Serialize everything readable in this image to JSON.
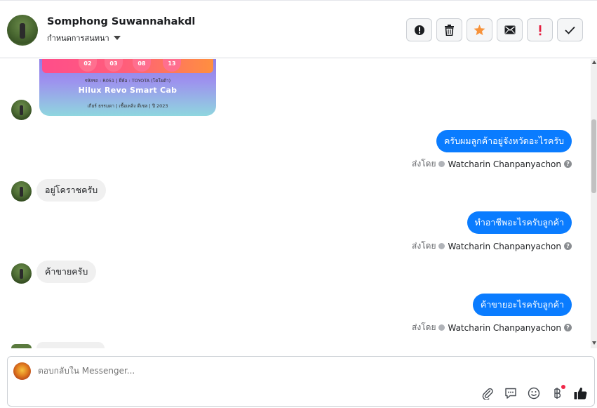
{
  "header": {
    "contact_name": "Somphong Suwannahakdl",
    "conversation_menu": "กำหนดการสนทนา",
    "actions": [
      "mark-spam",
      "delete",
      "star",
      "email",
      "important",
      "done"
    ]
  },
  "card": {
    "numbers": [
      "02",
      "03",
      "08",
      "13"
    ],
    "info_line": "รหัสรถ : R051 | ยี่ห้อ : TOYOTA (โตโยต้า)",
    "title": "Hilux Revo Smart Cab",
    "foot_line": "เกียร์ ธรรมดา | เชื้อเพลิง ดีเซล | ปี 2023"
  },
  "messages": [
    {
      "dir": "out",
      "text": "ครับผมลูกค้าอยู่จังหวัดอะไรครับ",
      "sent_by_label": "ส่งโดย",
      "sender": "Watcharin Chanpanyachon"
    },
    {
      "dir": "in",
      "text": "อยู่โคราชครับ"
    },
    {
      "dir": "out",
      "text": "ทำอาชีพอะไรครับลูกค้า",
      "sent_by_label": "ส่งโดย",
      "sender": "Watcharin Chanpanyachon"
    },
    {
      "dir": "in",
      "text": "ค้าขายครับ"
    },
    {
      "dir": "out",
      "text": "ค้าขายอะไรครับลูกค้า",
      "sent_by_label": "ส่งโดย",
      "sender": "Watcharin Chanpanyachon"
    }
  ],
  "composer": {
    "placeholder": "ตอบกลับใน Messenger..."
  },
  "colors": {
    "accent": "#0a7cff",
    "star": "#f7923a",
    "important": "#e41e3f"
  }
}
